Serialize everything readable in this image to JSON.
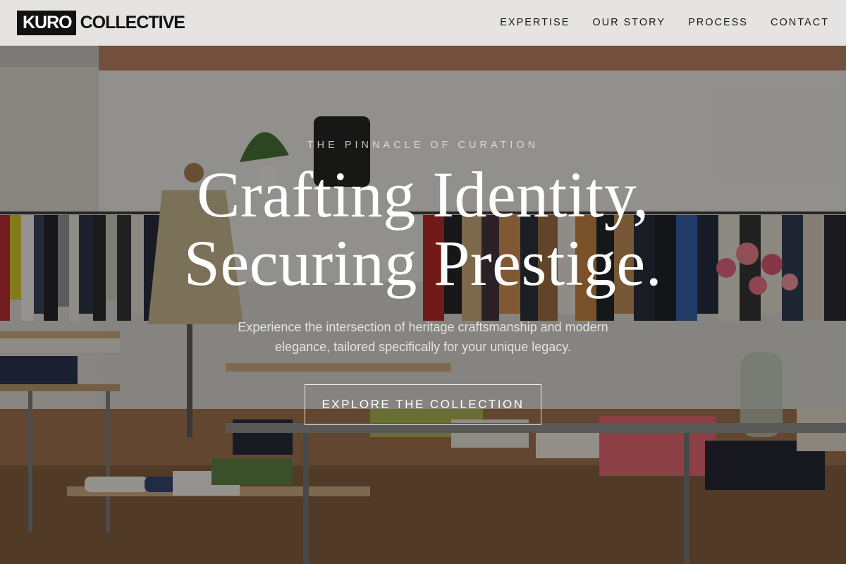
{
  "brand": {
    "logo_box": "KURO",
    "logo_text": "COLLECTIVE"
  },
  "nav": {
    "items": [
      {
        "label": "EXPERTISE"
      },
      {
        "label": "OUR STORY"
      },
      {
        "label": "PROCESS"
      },
      {
        "label": "CONTACT"
      }
    ]
  },
  "hero": {
    "eyebrow": "THE PINNACLE OF CURATION",
    "headline_line1": "Crafting Identity,",
    "headline_line2": "Securing Prestige.",
    "subtext": "Experience the intersection of heritage craftsmanship and modern elegance, tailored specifically for your unique legacy.",
    "cta_label": "EXPLORE THE COLLECTION",
    "background_image": "boutique clothing store interior with racks, folded garments on tables and a flower vase"
  },
  "colors": {
    "nav_background": "#eeece9",
    "logo_box": "#111111",
    "hero_text": "#ffffff",
    "overlay": "#141210"
  }
}
